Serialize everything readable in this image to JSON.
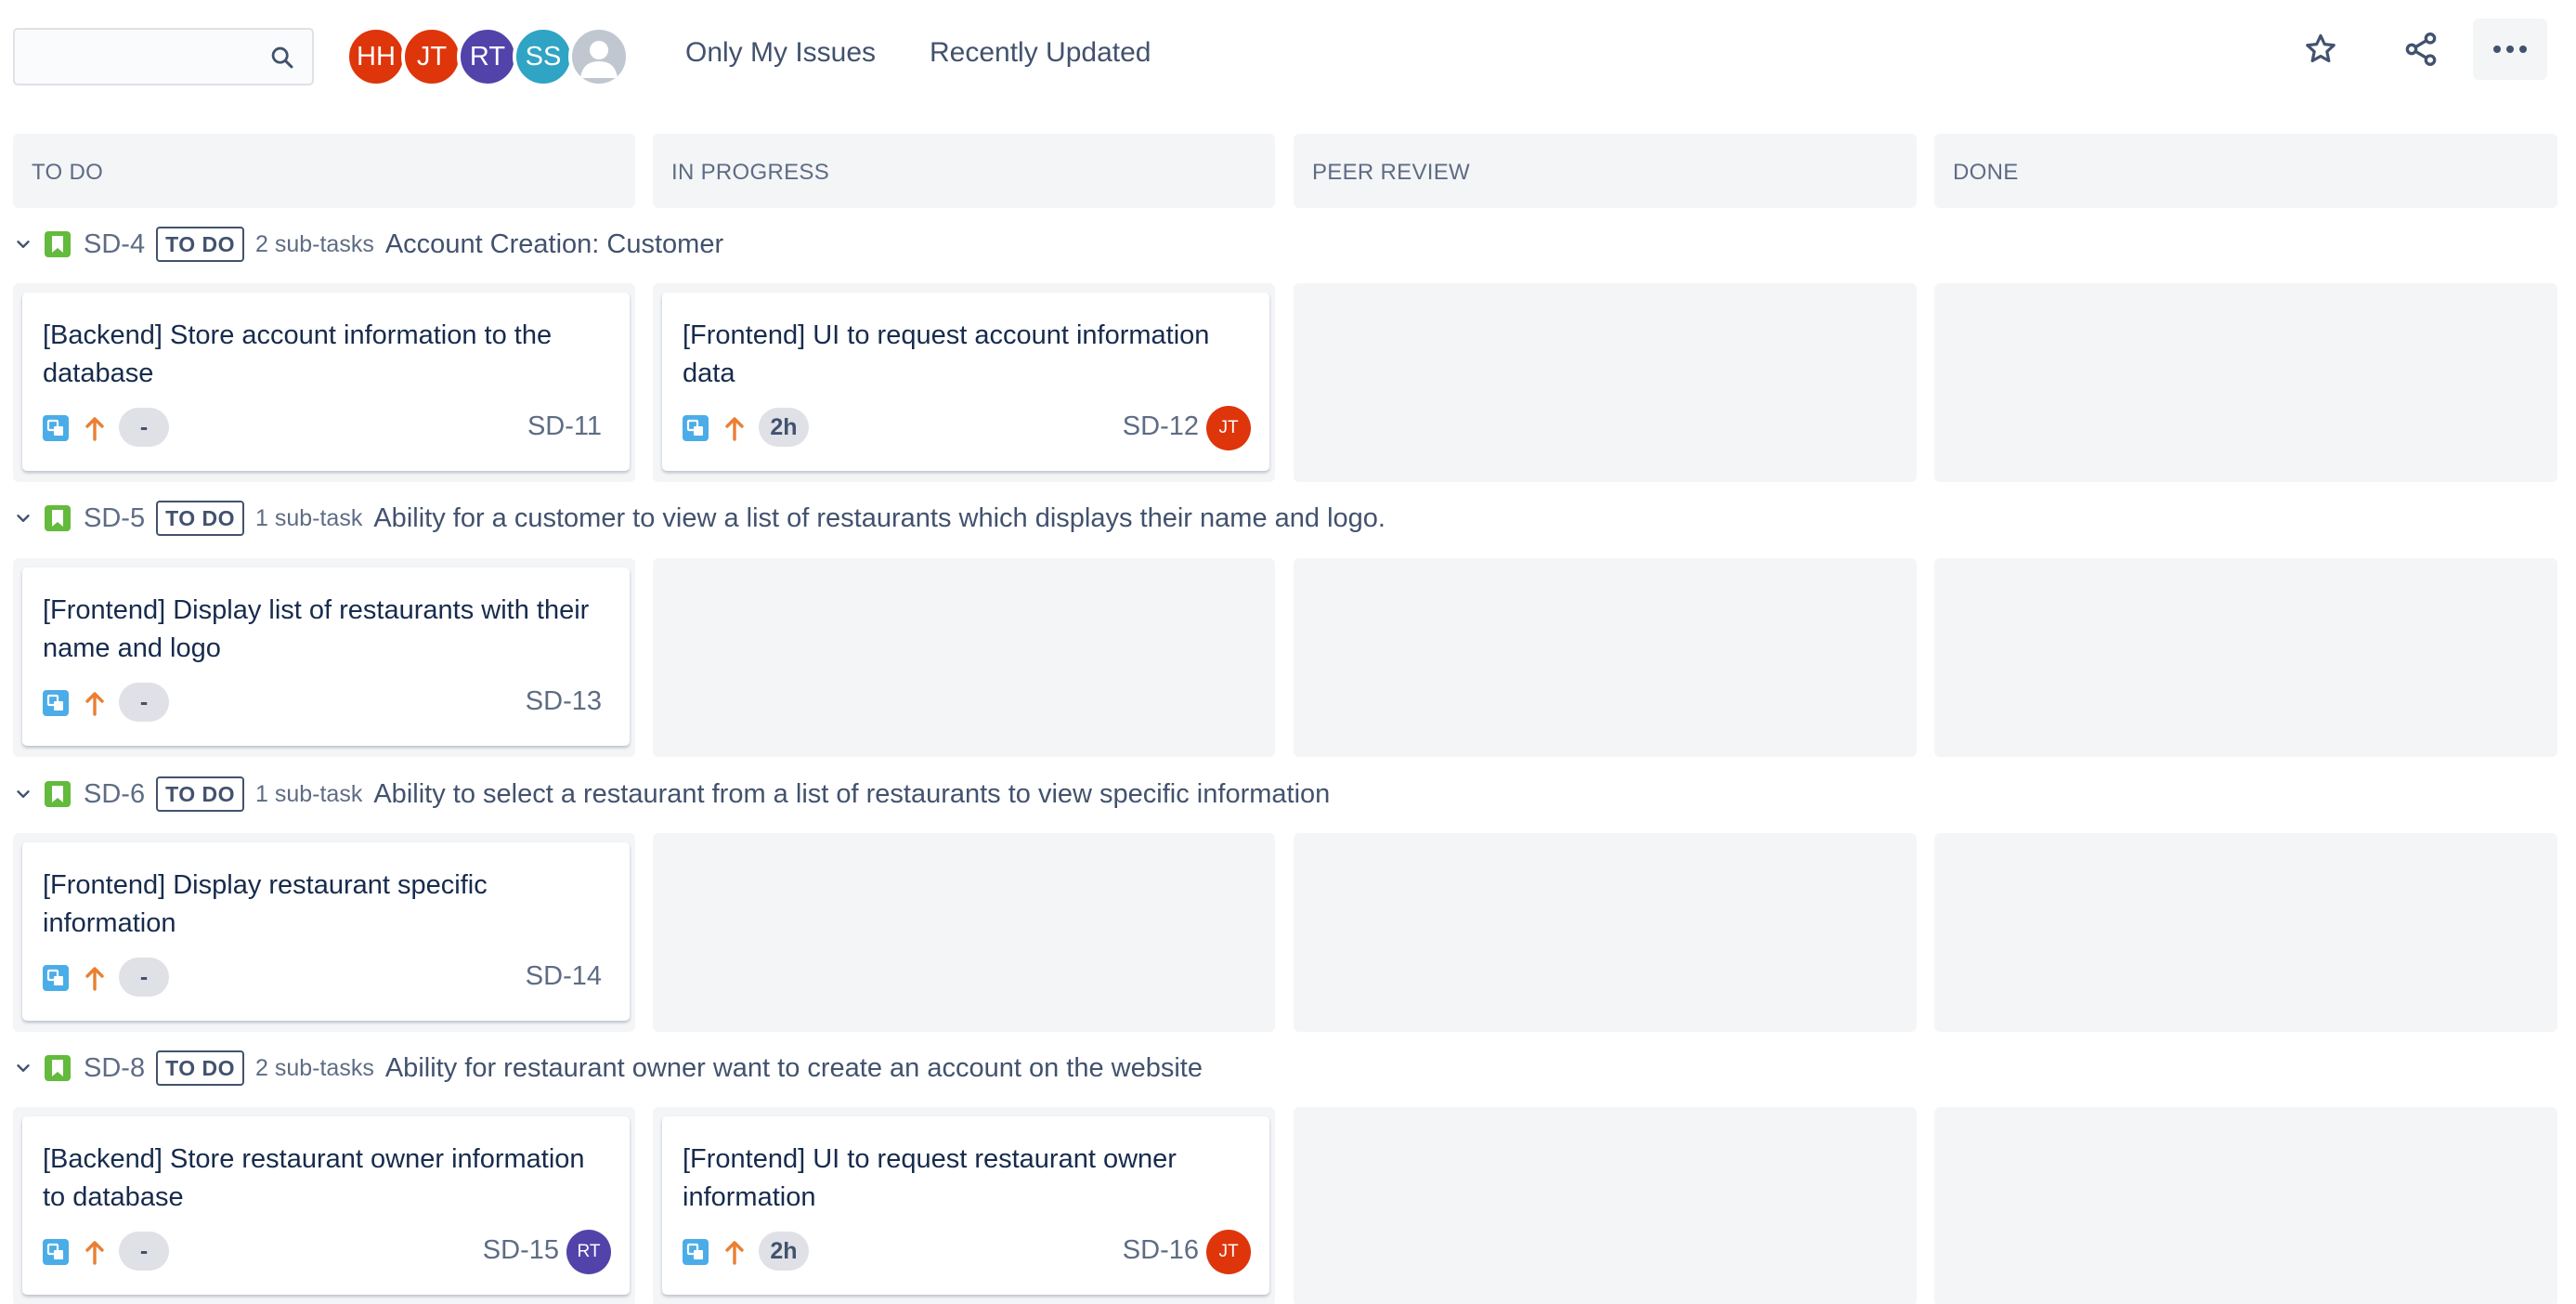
{
  "toolbar": {
    "search": {
      "value": "",
      "placeholder": ""
    },
    "avatars": [
      {
        "initials": "HH",
        "color": "#de350b"
      },
      {
        "initials": "JT",
        "color": "#de350b"
      },
      {
        "initials": "RT",
        "color": "#5243aa"
      },
      {
        "initials": "SS",
        "color": "#2fa4c4"
      },
      {
        "initials": "",
        "color": "#c1c7d0"
      }
    ],
    "filters": [
      "Only My Issues",
      "Recently Updated"
    ],
    "actions": {
      "star": "star-icon",
      "share": "share-icon",
      "more": "more-icon"
    }
  },
  "columns": [
    "TO DO",
    "IN PROGRESS",
    "PEER REVIEW",
    "DONE"
  ],
  "swimlanes": [
    {
      "key": "SD-4",
      "status": "TO DO",
      "subtasks": "2 sub-tasks",
      "summary": "Account Creation: Customer",
      "cards": [
        {
          "column": 0,
          "title": "[Backend] Store account information to the database",
          "estimate": "-",
          "key": "SD-11",
          "assignee": ""
        },
        {
          "column": 1,
          "title": "[Frontend] UI to request account information data",
          "estimate": "2h",
          "key": "SD-12",
          "assignee": "JT"
        }
      ]
    },
    {
      "key": "SD-5",
      "status": "TO DO",
      "subtasks": "1 sub-task",
      "summary": "Ability for a customer to view a list of restaurants which displays their name and logo.",
      "cards": [
        {
          "column": 0,
          "title": "[Frontend] Display list of restaurants with their name and logo",
          "estimate": "-",
          "key": "SD-13",
          "assignee": ""
        }
      ]
    },
    {
      "key": "SD-6",
      "status": "TO DO",
      "subtasks": "1 sub-task",
      "summary": "Ability to select a restaurant from a list of restaurants to view specific information",
      "cards": [
        {
          "column": 0,
          "title": "[Frontend] Display restaurant specific information",
          "estimate": "-",
          "key": "SD-14",
          "assignee": ""
        }
      ]
    },
    {
      "key": "SD-8",
      "status": "TO DO",
      "subtasks": "2 sub-tasks",
      "summary": "Ability for restaurant owner want to create an account on the website",
      "cards": [
        {
          "column": 0,
          "title": "[Backend] Store restaurant owner information to database",
          "estimate": "-",
          "key": "SD-15",
          "assignee": "RT"
        },
        {
          "column": 1,
          "title": "[Frontend] UI to request restaurant owner information",
          "estimate": "2h",
          "key": "SD-16",
          "assignee": "JT"
        }
      ]
    }
  ],
  "colors": {
    "story": "#63ba3c",
    "subtask": "#4bade8",
    "priority_high": "#e97f33",
    "column_bg": "#f4f5f7"
  }
}
